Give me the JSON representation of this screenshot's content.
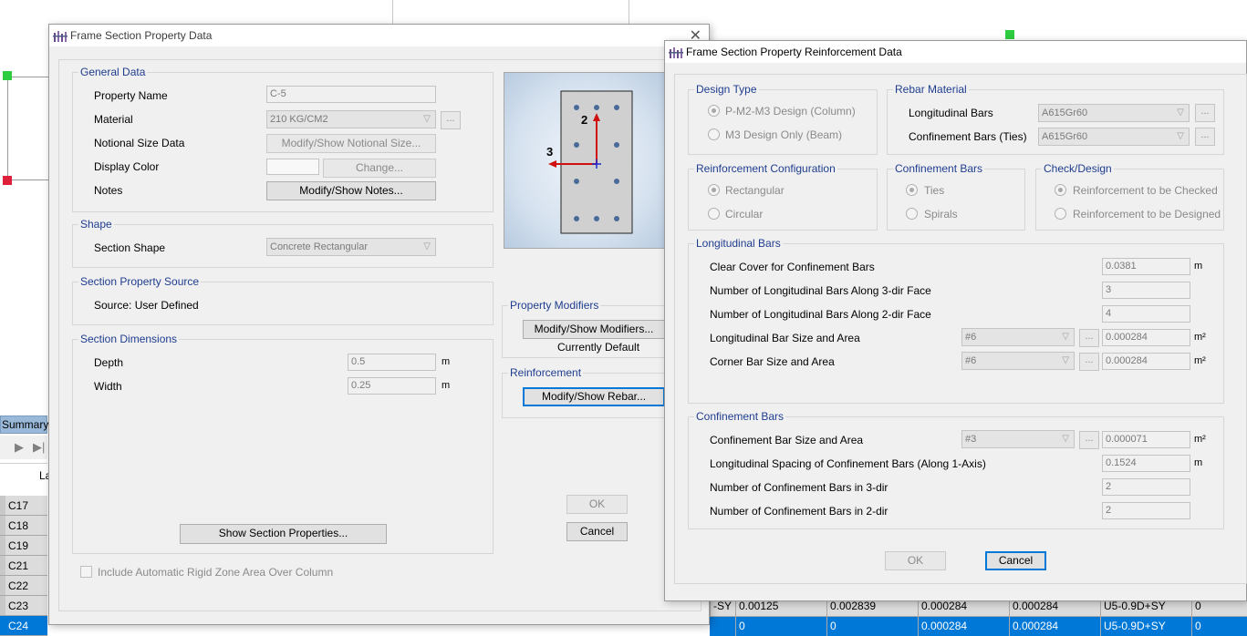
{
  "background": {
    "summary_label": "Summary",
    "column_header": "La",
    "rows": [
      "C17",
      "C18",
      "C19",
      "C21",
      "C22",
      "C23",
      "C24"
    ],
    "row23_tail": [
      "-SY",
      "0.00125",
      "0.002839",
      "0.000284",
      "0.000284",
      "U5-0.9D+SY",
      "0"
    ],
    "row24_tail": [
      "0",
      "0",
      "0.000284",
      "0.000284",
      "U5-0.9D+SY",
      "0"
    ]
  },
  "section_dialog": {
    "title": "Frame Section Property Data",
    "general": {
      "title": "General Data",
      "property_name_label": "Property Name",
      "property_name_value": "C-5",
      "material_label": "Material",
      "material_value": "210 KG/CM2",
      "ellipsis": "...",
      "notional_label": "Notional Size Data",
      "notional_button": "Modify/Show Notional Size...",
      "display_color_label": "Display Color",
      "change_button": "Change...",
      "notes_label": "Notes",
      "notes_button": "Modify/Show Notes..."
    },
    "shape": {
      "title": "Shape",
      "section_shape_label": "Section Shape",
      "section_shape_value": "Concrete Rectangular"
    },
    "source": {
      "title": "Section Property Source",
      "text": "Source:  User Defined"
    },
    "dimensions": {
      "title": "Section Dimensions",
      "depth_label": "Depth",
      "depth_value": "0.5",
      "width_label": "Width",
      "width_value": "0.25",
      "unit": "m"
    },
    "preview": {
      "axis2_label": "2",
      "axis3_label": "3"
    },
    "property_modifiers": {
      "title": "Property Modifiers",
      "button": "Modify/Show Modifiers...",
      "status": "Currently Default"
    },
    "reinforcement": {
      "title": "Reinforcement",
      "button": "Modify/Show Rebar..."
    },
    "show_properties_button": "Show Section Properties...",
    "rigid_zone_label": "Include Automatic Rigid Zone Area Over Column",
    "ok_label": "OK",
    "cancel_label": "Cancel"
  },
  "rebar_dialog": {
    "title": "Frame Section Property Reinforcement Data",
    "design_type": {
      "title": "Design Type",
      "option1": "P-M2-M3 Design  (Column)",
      "option2": "M3 Design Only  (Beam)"
    },
    "rebar_material": {
      "title": "Rebar Material",
      "longitudinal_label": "Longitudinal Bars",
      "longitudinal_value": "A615Gr60",
      "confinement_label": "Confinement Bars (Ties)",
      "confinement_value": "A615Gr60",
      "ellipsis": "..."
    },
    "configuration": {
      "title": "Reinforcement Configuration",
      "option1": "Rectangular",
      "option2": "Circular"
    },
    "confinement_type": {
      "title": "Confinement Bars",
      "option1": "Ties",
      "option2": "Spirals"
    },
    "check_design": {
      "title": "Check/Design",
      "option1": "Reinforcement to be Checked",
      "option2": "Reinforcement to be Designed"
    },
    "longitudinal": {
      "title": "Longitudinal Bars",
      "clear_cover_label": "Clear Cover for Confinement Bars",
      "clear_cover_value": "0.0381",
      "clear_cover_unit": "m",
      "num3_label": "Number of Longitudinal Bars Along 3-dir Face",
      "num3_value": "3",
      "num2_label": "Number of Longitudinal Bars Along 2-dir Face",
      "num2_value": "4",
      "bar_size_label": "Longitudinal Bar Size and Area",
      "bar_size_value": "#6",
      "bar_area_value": "0.000284",
      "corner_label": "Corner Bar Size and Area",
      "corner_size_value": "#6",
      "corner_area_value": "0.000284",
      "area_unit": "m²"
    },
    "confinement": {
      "title": "Confinement Bars",
      "bar_size_label": "Confinement Bar Size and Area",
      "bar_size_value": "#3",
      "bar_area_value": "0.000071",
      "area_unit": "m²",
      "spacing_label": "Longitudinal Spacing of Confinement Bars  (Along 1-Axis)",
      "spacing_value": "0.1524",
      "spacing_unit": "m",
      "num3_label": "Number of Confinement Bars in 3-dir",
      "num3_value": "2",
      "num2_label": "Number of Confinement Bars in 2-dir",
      "num2_value": "2"
    },
    "ok_label": "OK",
    "cancel_label": "Cancel"
  }
}
